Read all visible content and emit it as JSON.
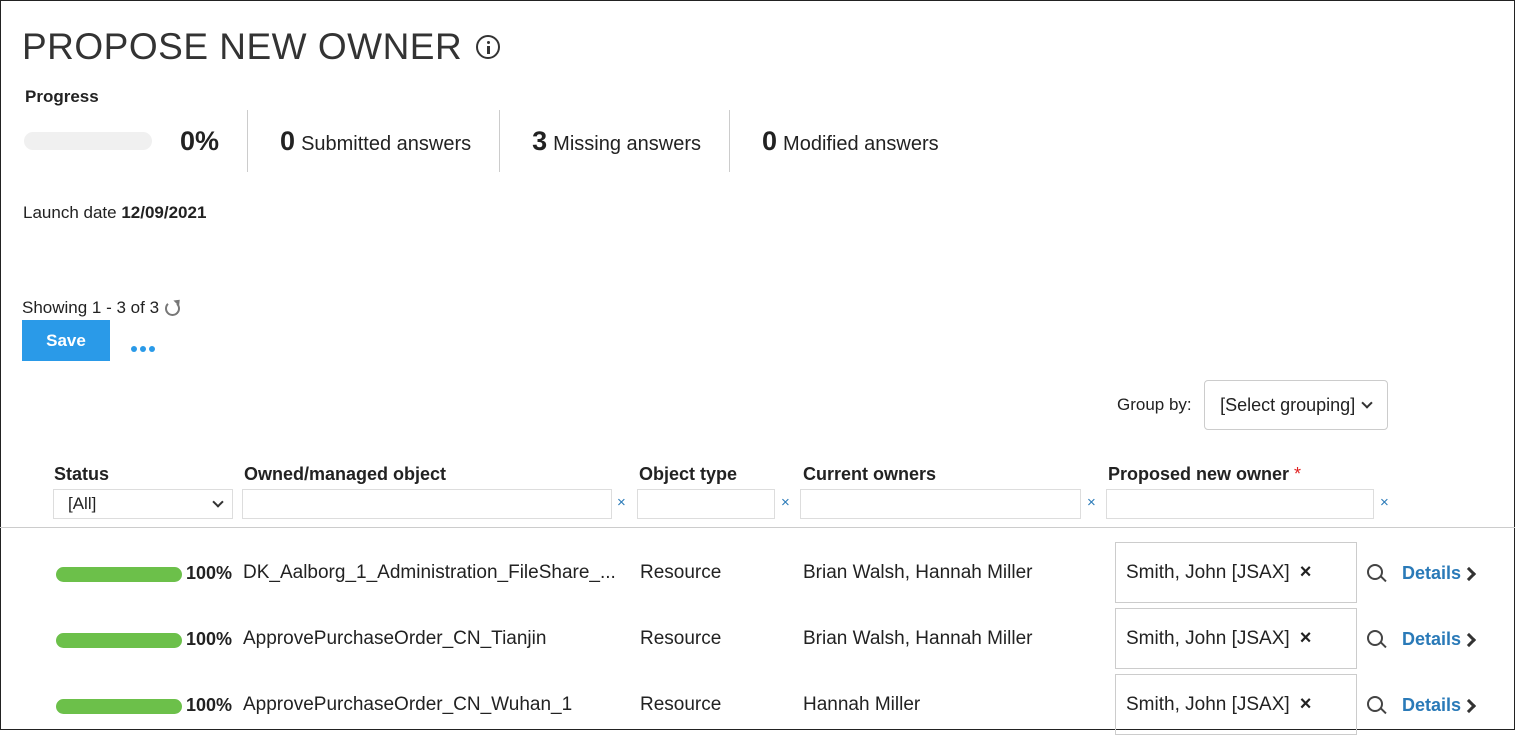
{
  "page": {
    "title": "PROPOSE NEW OWNER",
    "progress_label": "Progress",
    "progress_pct": "0%",
    "progress_value": 0,
    "stats": [
      {
        "count": "0",
        "label": "Submitted answers"
      },
      {
        "count": "3",
        "label": "Missing answers"
      },
      {
        "count": "0",
        "label": "Modified answers"
      }
    ],
    "launch_label": "Launch date",
    "launch_date": "12/09/2021",
    "showing": "Showing 1 - 3 of 3"
  },
  "toolbar": {
    "save_label": "Save"
  },
  "groupby": {
    "label": "Group by:",
    "value": "[Select grouping]"
  },
  "table": {
    "headers": {
      "status": "Status",
      "object": "Owned/managed object",
      "type": "Object type",
      "owners": "Current owners",
      "proposed": "Proposed new owner",
      "required_mark": "*"
    },
    "status_filter": "[All]",
    "clear_glyph": "×",
    "details_label": "Details",
    "rows": [
      {
        "pct": "100%",
        "object": "DK_Aalborg_1_Administration_FileShare_...",
        "type": "Resource",
        "owners": "Brian Walsh, Hannah Miller",
        "proposed": "Smith, John [JSAX]",
        "remove": "×"
      },
      {
        "pct": "100%",
        "object": "ApprovePurchaseOrder_CN_Tianjin",
        "type": "Resource",
        "owners": "Brian Walsh, Hannah Miller",
        "proposed": "Smith, John [JSAX]",
        "remove": "×"
      },
      {
        "pct": "100%",
        "object": "ApprovePurchaseOrder_CN_Wuhan_1",
        "type": "Resource",
        "owners": "Hannah Miller",
        "proposed": "Smith, John [JSAX]",
        "remove": "×"
      }
    ]
  },
  "colors": {
    "accent": "#2a9ae8",
    "link": "#2a7ab8",
    "progress_complete": "#6cc04a",
    "required": "#e02020"
  }
}
